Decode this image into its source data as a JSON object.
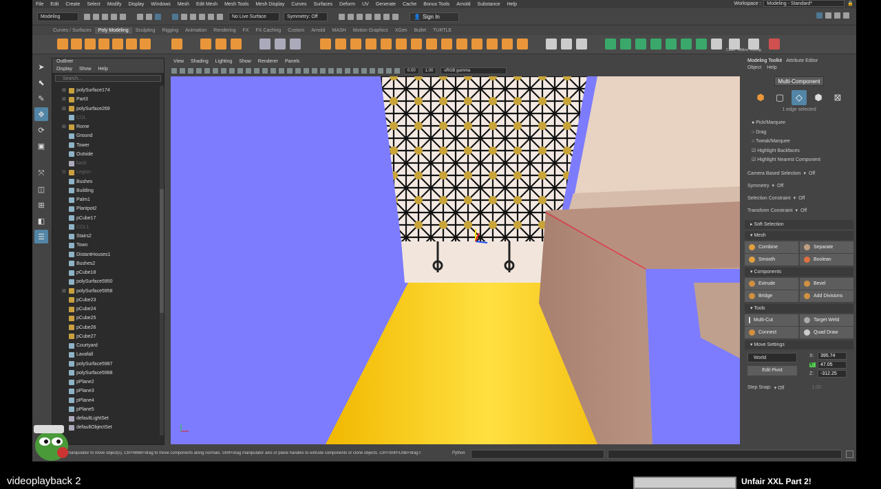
{
  "menubar": {
    "items": [
      "File",
      "Edit",
      "Create",
      "Select",
      "Modify",
      "Display",
      "Windows",
      "Mesh",
      "Edit Mesh",
      "Mesh Tools",
      "Mesh Display",
      "Curves",
      "Surfaces",
      "Deform",
      "UV",
      "Generate",
      "Cache",
      "Bonus Tools",
      "Arnold",
      "Substance",
      "Help"
    ],
    "workspace_label": "Workspace :",
    "workspace_value": "Modeling - Standard*"
  },
  "statusline": {
    "mode": "Modeling",
    "live_surface": "No Live Surface",
    "symmetry": "Symmetry: Off",
    "sign_in": "Sign In"
  },
  "shelf": {
    "tabs": [
      "Curves / Surfaces",
      "Poly Modeling",
      "Sculpting",
      "Rigging",
      "Animation",
      "Rendering",
      "FX",
      "FX Caching",
      "Custom",
      "Arnold",
      "MASH",
      "Motion Graphics",
      "XGen",
      "Bullet",
      "TURTLE"
    ],
    "active_tab": "Poly Modeling",
    "right_labels": [
      "Cutter",
      "MMirro",
      "kWedg"
    ]
  },
  "outliner": {
    "title": "Outliner",
    "menu": [
      "Display",
      "Show",
      "Help"
    ],
    "search_placeholder": "Search...",
    "items": [
      {
        "name": "polySurface174",
        "exp": "+",
        "kind": "grp"
      },
      {
        "name": "Part3",
        "exp": "+",
        "kind": "grp"
      },
      {
        "name": "polySurface269",
        "exp": "+",
        "kind": "grp"
      },
      {
        "name": "COL",
        "exp": "",
        "kind": "mesh",
        "dim": true
      },
      {
        "name": "Rome",
        "exp": "+",
        "kind": "grp"
      },
      {
        "name": "Ground",
        "exp": "",
        "kind": "mesh"
      },
      {
        "name": "Tower",
        "exp": "",
        "kind": "mesh"
      },
      {
        "name": "Outside",
        "exp": "",
        "kind": "mesh"
      },
      {
        "name": "back",
        "exp": "",
        "kind": "cam",
        "dim": true
      },
      {
        "name": "Legion",
        "exp": "+",
        "kind": "grp",
        "dim": true
      },
      {
        "name": "Bushes",
        "exp": "",
        "kind": "mesh"
      },
      {
        "name": "Building",
        "exp": "",
        "kind": "mesh"
      },
      {
        "name": "Palm1",
        "exp": "",
        "kind": "mesh"
      },
      {
        "name": "Plantpot2",
        "exp": "",
        "kind": "mesh"
      },
      {
        "name": "pCube17",
        "exp": "",
        "kind": "mesh"
      },
      {
        "name": "COL1",
        "exp": "",
        "kind": "mesh",
        "dim": true
      },
      {
        "name": "Stairs2",
        "exp": "",
        "kind": "mesh"
      },
      {
        "name": "Town",
        "exp": "",
        "kind": "mesh"
      },
      {
        "name": "DistantHouses1",
        "exp": "",
        "kind": "mesh"
      },
      {
        "name": "Bushes2",
        "exp": "",
        "kind": "mesh"
      },
      {
        "name": "pCube18",
        "exp": "",
        "kind": "mesh"
      },
      {
        "name": "polySurface5950",
        "exp": "",
        "kind": "mesh"
      },
      {
        "name": "polySurface5958",
        "exp": "+",
        "kind": "grp"
      },
      {
        "name": "pCube23",
        "exp": "",
        "kind": "grp"
      },
      {
        "name": "pCube24",
        "exp": "",
        "kind": "grp"
      },
      {
        "name": "pCube25",
        "exp": "",
        "kind": "grp"
      },
      {
        "name": "pCube26",
        "exp": "",
        "kind": "grp"
      },
      {
        "name": "pCube27",
        "exp": "",
        "kind": "grp"
      },
      {
        "name": "Courtyard",
        "exp": "",
        "kind": "mesh"
      },
      {
        "name": "Lavafall",
        "exp": "",
        "kind": "mesh"
      },
      {
        "name": "polySurface5987",
        "exp": "",
        "kind": "mesh"
      },
      {
        "name": "polySurface5988",
        "exp": "",
        "kind": "mesh"
      },
      {
        "name": "pPlane2",
        "exp": "",
        "kind": "mesh"
      },
      {
        "name": "pPlane3",
        "exp": "",
        "kind": "mesh"
      },
      {
        "name": "pPlane4",
        "exp": "",
        "kind": "mesh"
      },
      {
        "name": "pPlane5",
        "exp": "",
        "kind": "mesh"
      },
      {
        "name": "defaultLightSet",
        "exp": "",
        "kind": "set"
      },
      {
        "name": "defaultObjectSet",
        "exp": "",
        "kind": "set"
      }
    ]
  },
  "viewport": {
    "menu": [
      "View",
      "Shading",
      "Lighting",
      "Show",
      "Renderer",
      "Panels"
    ],
    "field_a": "0.00",
    "field_b": "1.00",
    "colorspace": "sRGB gamma"
  },
  "toolkit": {
    "tabs": [
      "Modeling Toolkit",
      "Attribute Editor"
    ],
    "menu": [
      "Object",
      "Help"
    ],
    "multi_component": "Multi-Component",
    "edge_selected": "1 edge selected",
    "pick_options": [
      "Pick/Marquee",
      "Drag",
      "Tweak/Marquee"
    ],
    "checks": [
      "Highlight Backfaces",
      "Highlight Nearest Component"
    ],
    "camera_based": "Camera Based Selection",
    "camera_based_val": "Off",
    "symmetry": "Symmetry",
    "symmetry_val": "Off",
    "selection_constraint": "Selection Constraint",
    "selection_constraint_val": "Off",
    "transform_constraint": "Transform Constraint",
    "transform_constraint_val": "Off",
    "soft_selection": "Soft Selection",
    "sections": {
      "mesh": "Mesh",
      "components": "Components",
      "tools": "Tools",
      "move": "Move Settings"
    },
    "mesh_buttons": [
      "Combine",
      "Separate",
      "Smooth",
      "Boolean"
    ],
    "component_buttons": [
      "Extrude",
      "Bevel",
      "Bridge",
      "Add Divisions"
    ],
    "tool_buttons": [
      "Multi-Cut",
      "Target Weld",
      "Connect",
      "Quad Draw"
    ],
    "move": {
      "space": "World",
      "edit_pivot": "Edit Pivot",
      "x_label": "X:",
      "x": "395.74",
      "y_label": "Y:",
      "y": "47.05",
      "z_label": "Z:",
      "z": "-312.25",
      "step_snap": "Step Snap:",
      "step_val": "Off",
      "step_num": "1.00"
    }
  },
  "commandline": {
    "help": "e manipulator to move object(s). Ctrl+MMB+drag to move components along normals. Shift+drag manipulator axis or plane handles to extrude components or clone objects. Ctrl+Shift+LMB+drag t",
    "language": "Python"
  },
  "page": {
    "video_title": "videoplayback 2",
    "next_title": "Unfair XXL Part 2!"
  },
  "colors": {
    "accent": "#5285a6",
    "viewport_bg": "#7d7cff",
    "floor": "#f5c400"
  }
}
